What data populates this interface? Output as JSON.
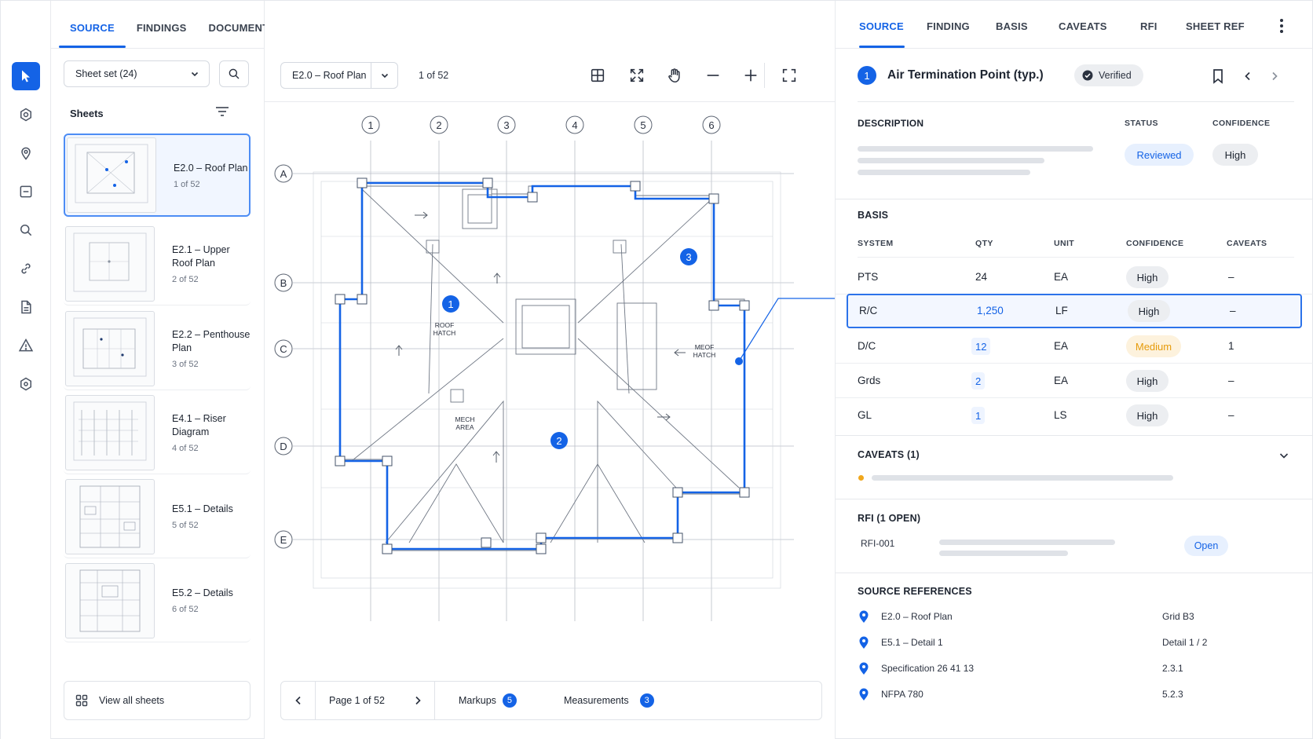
{
  "rail": {
    "items": [
      {
        "icon": "cursor-icon",
        "active": true
      },
      {
        "icon": "settings-hex-icon"
      },
      {
        "icon": "location-pin-icon"
      },
      {
        "icon": "minus-box-icon"
      },
      {
        "icon": "search-icon"
      },
      {
        "icon": "link-icon"
      },
      {
        "icon": "document-icon"
      },
      {
        "icon": "warning-icon"
      },
      {
        "icon": "hex-settings-icon"
      }
    ]
  },
  "left_tabs": [
    "SOURCE",
    "FINDINGS",
    "DOCUMENTS"
  ],
  "sheet_set": {
    "label": "Sheet set (24)"
  },
  "sheets_header": "Sheets",
  "sheets": [
    {
      "name": "E2.0 – Roof Plan",
      "page": "1 of 52"
    },
    {
      "name": "E2.1 – Upper Roof Plan",
      "page": "2 of 52"
    },
    {
      "name": "E2.2 – Penthouse Plan",
      "page": "3 of 52"
    },
    {
      "name": "E4.1 – Riser Diagram",
      "page": "4 of 52"
    },
    {
      "name": "E5.1 – Details",
      "page": "5 of 52"
    },
    {
      "name": "E5.2 – Details",
      "page": "6 of 52"
    }
  ],
  "view_all": "View all sheets",
  "viewer": {
    "sheet_select": "E2.0 – Roof Plan",
    "page_count": "1 of 52",
    "grid_cols": [
      "1",
      "2",
      "3",
      "4",
      "5",
      "6"
    ],
    "grid_rows": [
      "A",
      "B",
      "C",
      "D",
      "E"
    ],
    "labels": {
      "roof_hatch": [
        "ROOF",
        "HATCH"
      ],
      "mech_area": [
        "MECH",
        "AREA"
      ],
      "meof_hatch": [
        "MEOF",
        "HATCH"
      ]
    },
    "markers": [
      "1",
      "2",
      "3"
    ],
    "footer": {
      "page": "Page 1 of 52",
      "markups_label": "Markups",
      "markups_count": "5",
      "measurements_label": "Measurements",
      "measurements_count": "3"
    }
  },
  "right_tabs": [
    "SOURCE",
    "FINDING",
    "BASIS",
    "CAVEATS",
    "RFI",
    "SHEET REF"
  ],
  "finding": {
    "number": "1",
    "title": "Air Termination Point (typ.)",
    "verified": "Verified",
    "description_label": "DESCRIPTION",
    "status_label": "STATUS",
    "confidence_label": "CONFIDENCE",
    "status": "Reviewed",
    "confidence": "High"
  },
  "basis": {
    "title": "BASIS",
    "columns": [
      "SYSTEM",
      "QTY",
      "UNIT",
      "CONFIDENCE",
      "CAVEATS"
    ],
    "rows": [
      {
        "system": "PTS",
        "qty": "24",
        "unit": "EA",
        "confidence": "High",
        "caveats": "–"
      },
      {
        "system": "R/C",
        "qty": "1,250",
        "unit": "LF",
        "confidence": "High",
        "caveats": "–"
      },
      {
        "system": "D/C",
        "qty": "12",
        "unit": "EA",
        "confidence": "Medium",
        "caveats": "1"
      },
      {
        "system": "Grds",
        "qty": "2",
        "unit": "EA",
        "confidence": "High",
        "caveats": "–"
      },
      {
        "system": "GL",
        "qty": "1",
        "unit": "LS",
        "confidence": "High",
        "caveats": "–"
      }
    ]
  },
  "caveats": {
    "title": "CAVEATS (1)"
  },
  "rfi": {
    "title": "RFI (1 OPEN)",
    "id": "RFI-001",
    "status": "Open"
  },
  "source_refs": {
    "title": "SOURCE REFERENCES",
    "items": [
      {
        "name": "E2.0 – Roof Plan",
        "ref": "Grid B3"
      },
      {
        "name": "E5.1 – Detail 1",
        "ref": "Detail 1 / 2"
      },
      {
        "name": "Specification 26 41 13",
        "ref": "2.3.1"
      },
      {
        "name": "NFPA 780",
        "ref": "5.2.3"
      }
    ]
  },
  "colors": {
    "accent": "#1463e6",
    "amber": "#e69b0b",
    "verified_bg": "#eceef1"
  }
}
